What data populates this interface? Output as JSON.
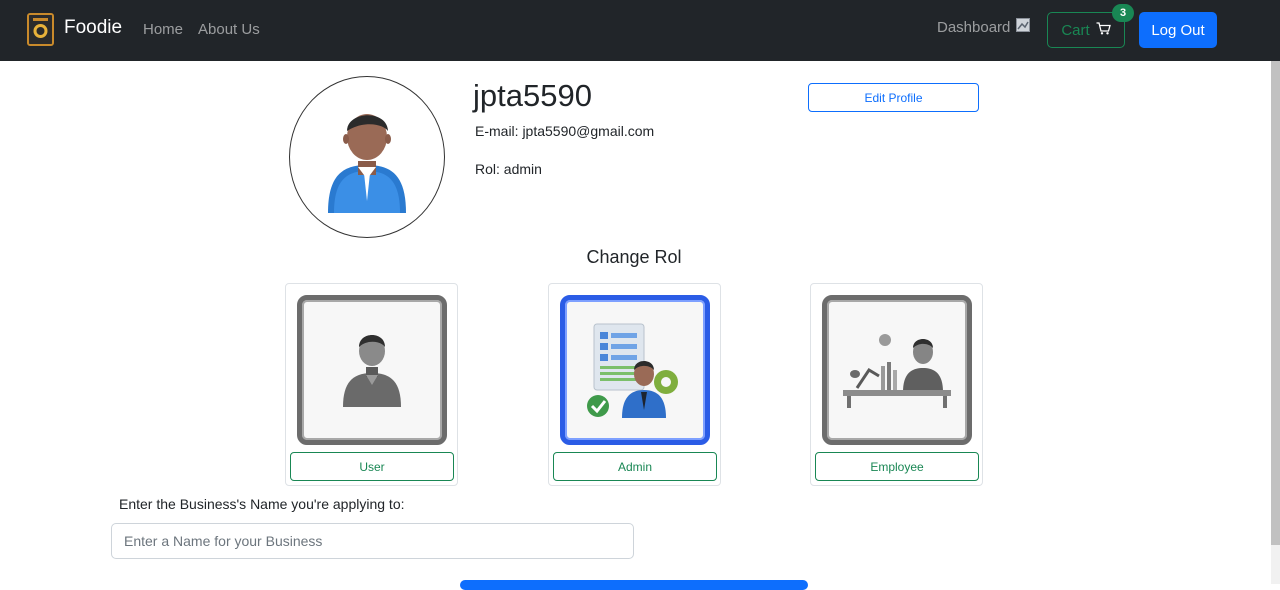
{
  "navbar": {
    "brand": "Foodie",
    "links": [
      "Home",
      "About Us"
    ],
    "dashboard_label": "Dashboard",
    "dashboard_icon": "broken-image-icon",
    "cart_label": "Cart",
    "cart_icon": "cart-icon",
    "cart_count": "3",
    "logout_label": "Log Out"
  },
  "profile": {
    "username": "jpta5590",
    "email_line": "E-mail: jpta5590@gmail.com",
    "rol_line": "Rol: admin",
    "edit_label": "Edit Profile"
  },
  "change_rol": {
    "title": "Change Rol",
    "roles": [
      {
        "label": "User",
        "icon": "user-role-icon",
        "selected": false
      },
      {
        "label": "Admin",
        "icon": "admin-role-icon",
        "selected": true
      },
      {
        "label": "Employee",
        "icon": "employee-role-icon",
        "selected": false
      }
    ]
  },
  "business": {
    "label": "Enter the Business's Name you're applying to:",
    "placeholder": "Enter a Name for your Business",
    "value": ""
  },
  "colors": {
    "navbar_bg": "#212529",
    "primary": "#0d6efd",
    "success": "#198754",
    "selected_frame": "#2b5ce6"
  }
}
